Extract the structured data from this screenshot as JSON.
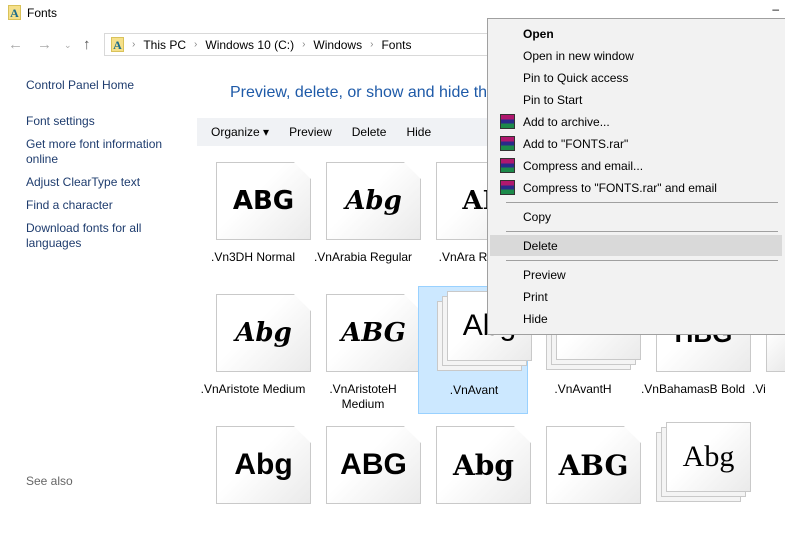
{
  "window": {
    "title": "Fonts",
    "minimize": "–"
  },
  "address": {
    "crumbs": [
      "This PC",
      "Windows 10 (C:)",
      "Windows",
      "Fonts"
    ]
  },
  "sidebar": {
    "home": "Control Panel Home",
    "links": [
      "Font settings",
      "Get more font information online",
      "Adjust ClearType text",
      "Find a character",
      "Download fonts for all languages"
    ],
    "see_also": "See also"
  },
  "heading": "Preview, delete, or show and hide the",
  "toolbar": {
    "organize": "Organize ▾",
    "preview": "Preview",
    "delete": "Delete",
    "hide": "Hide"
  },
  "fonts": [
    {
      "name": ".Vn3DH Normal",
      "sample": "ABG"
    },
    {
      "name": ".VnArabia Regular",
      "sample": "Abg"
    },
    {
      "name": ".VnAra Regu",
      "sample": "AB"
    },
    {
      "name": ".VnAristote Medium",
      "sample": "Abg"
    },
    {
      "name": ".VnAristoteH Medium",
      "sample": "ABG"
    },
    {
      "name": ".VnAvant",
      "sample": "Abg",
      "selected": true,
      "stack": true
    },
    {
      "name": ".VnAvantH",
      "sample": "ABG",
      "stack": true
    },
    {
      "name": ".VnBahamasB Bold",
      "sample": "HBG"
    },
    {
      "name": ".Vi",
      "sample": ""
    },
    {
      "name": "",
      "sample": "Abg"
    },
    {
      "name": "",
      "sample": "ABG"
    },
    {
      "name": "",
      "sample": "Abg"
    },
    {
      "name": "",
      "sample": "ABG"
    },
    {
      "name": "",
      "sample": "Abg",
      "stack": true
    }
  ],
  "context_menu": {
    "items": [
      {
        "label": "Open",
        "bold": true
      },
      {
        "label": "Open in new window"
      },
      {
        "label": "Pin to Quick access"
      },
      {
        "label": "Pin to Start"
      },
      {
        "label": "Add to archive...",
        "icon": "winrar-icon"
      },
      {
        "label": "Add to \"FONTS.rar\"",
        "icon": "winrar-icon"
      },
      {
        "label": "Compress and email...",
        "icon": "winrar-icon"
      },
      {
        "label": "Compress to \"FONTS.rar\" and email",
        "icon": "winrar-icon"
      },
      {
        "label": "Copy",
        "sep_before": true
      },
      {
        "label": "Delete",
        "sep_before": true,
        "highlight": true
      },
      {
        "label": "Preview",
        "sep_before": true
      },
      {
        "label": "Print"
      },
      {
        "label": "Hide"
      }
    ]
  }
}
